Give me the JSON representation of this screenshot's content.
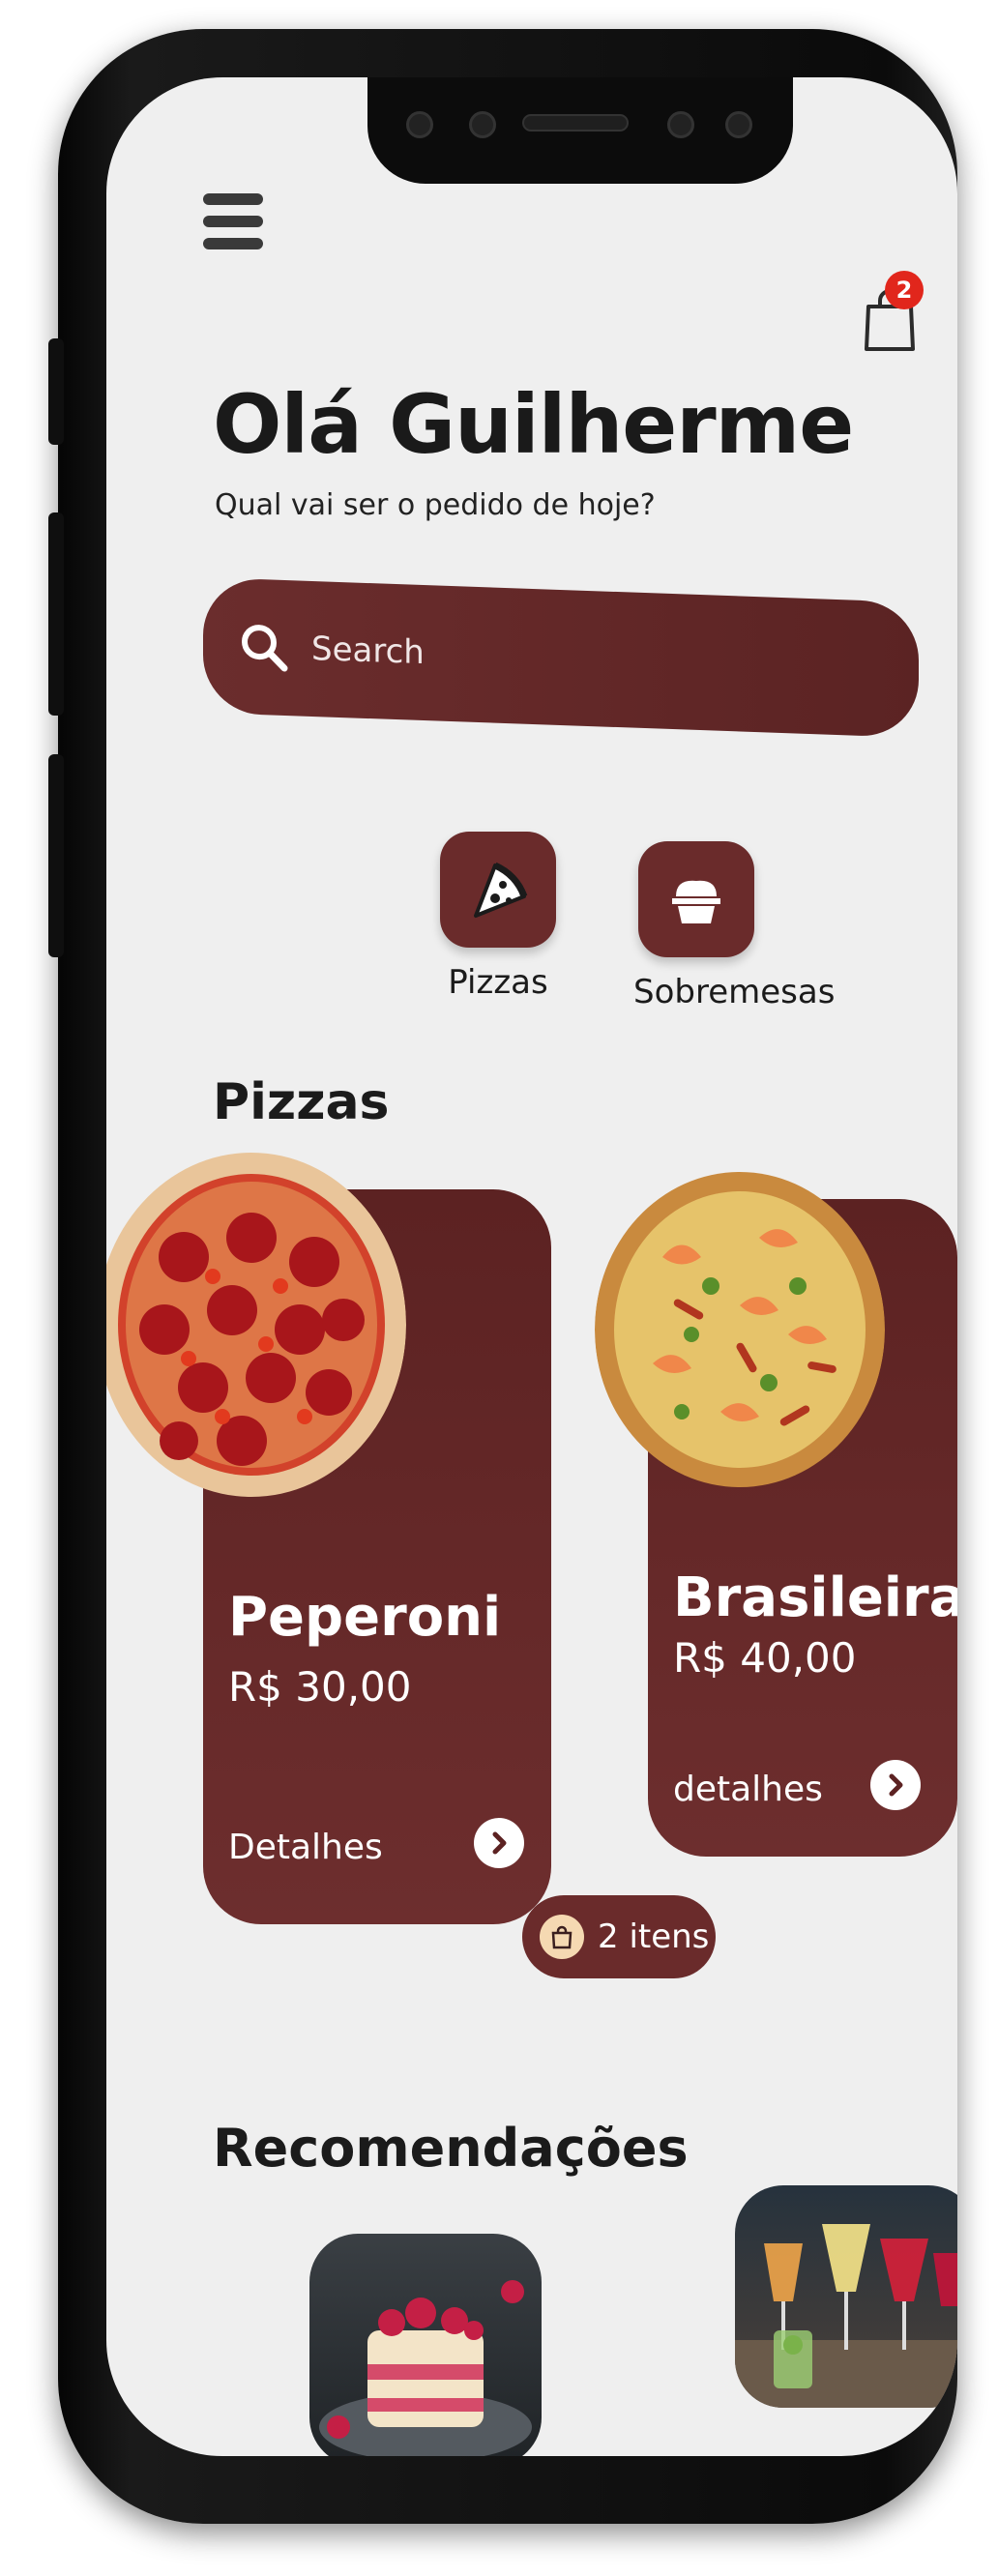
{
  "header": {
    "greeting": "Olá Guilherme",
    "subtitle": "Qual vai ser o pedido de hoje?",
    "cart_badge": "2"
  },
  "search": {
    "placeholder": "Search"
  },
  "categories": [
    {
      "label": "Pizzas",
      "icon": "pizza-slice-icon"
    },
    {
      "label": "Sobremesas",
      "icon": "cupcake-icon"
    }
  ],
  "sections": {
    "pizzas_title": "Pizzas",
    "recommendations_title": "Recomendações"
  },
  "pizzas": [
    {
      "name": "Peperoni",
      "price": "R$ 30,00",
      "details": "Detalhes"
    },
    {
      "name": "Brasileira",
      "price": "R$ 40,00",
      "details": "detalhes"
    }
  ],
  "cart_summary": {
    "label": "2 itens"
  },
  "colors": {
    "brand": "#6a2b2b",
    "badge": "#e1261c",
    "background": "#efefef"
  }
}
